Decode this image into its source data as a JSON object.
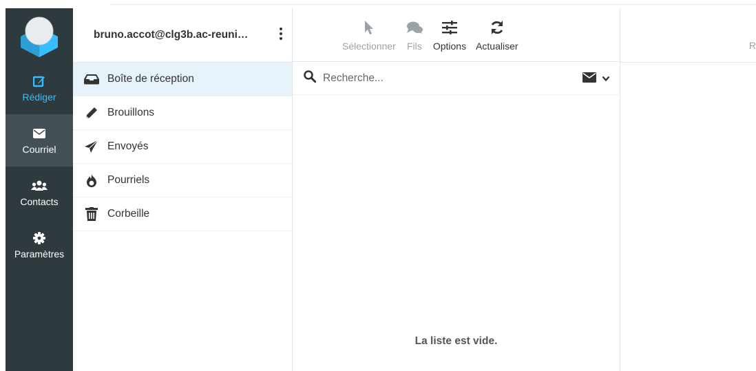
{
  "nav": {
    "items": [
      {
        "label": "Rédiger",
        "icon": "compose-icon"
      },
      {
        "label": "Courriel",
        "icon": "envelope-icon"
      },
      {
        "label": "Contacts",
        "icon": "users-icon"
      },
      {
        "label": "Paramètres",
        "icon": "gear-icon"
      }
    ],
    "active": "Courriel",
    "accent_color": "#37beff"
  },
  "account": {
    "email": "bruno.accot@clg3b.ac-reuni…"
  },
  "folders": [
    {
      "label": "Boîte de réception",
      "icon": "inbox-icon",
      "selected": true
    },
    {
      "label": "Brouillons",
      "icon": "pencil-icon"
    },
    {
      "label": "Envoyés",
      "icon": "paper-plane-icon"
    },
    {
      "label": "Pourriels",
      "icon": "fire-icon"
    },
    {
      "label": "Corbeille",
      "icon": "trash-icon"
    }
  ],
  "toolbar": {
    "select_label": "Sélectionner",
    "threads_label": "Fils",
    "options_label": "Options",
    "refresh_label": "Actualiser"
  },
  "search": {
    "placeholder": "Recherche..."
  },
  "list": {
    "empty_message": "La liste est vide."
  },
  "preview": {
    "toolbar_fragment": "R"
  }
}
